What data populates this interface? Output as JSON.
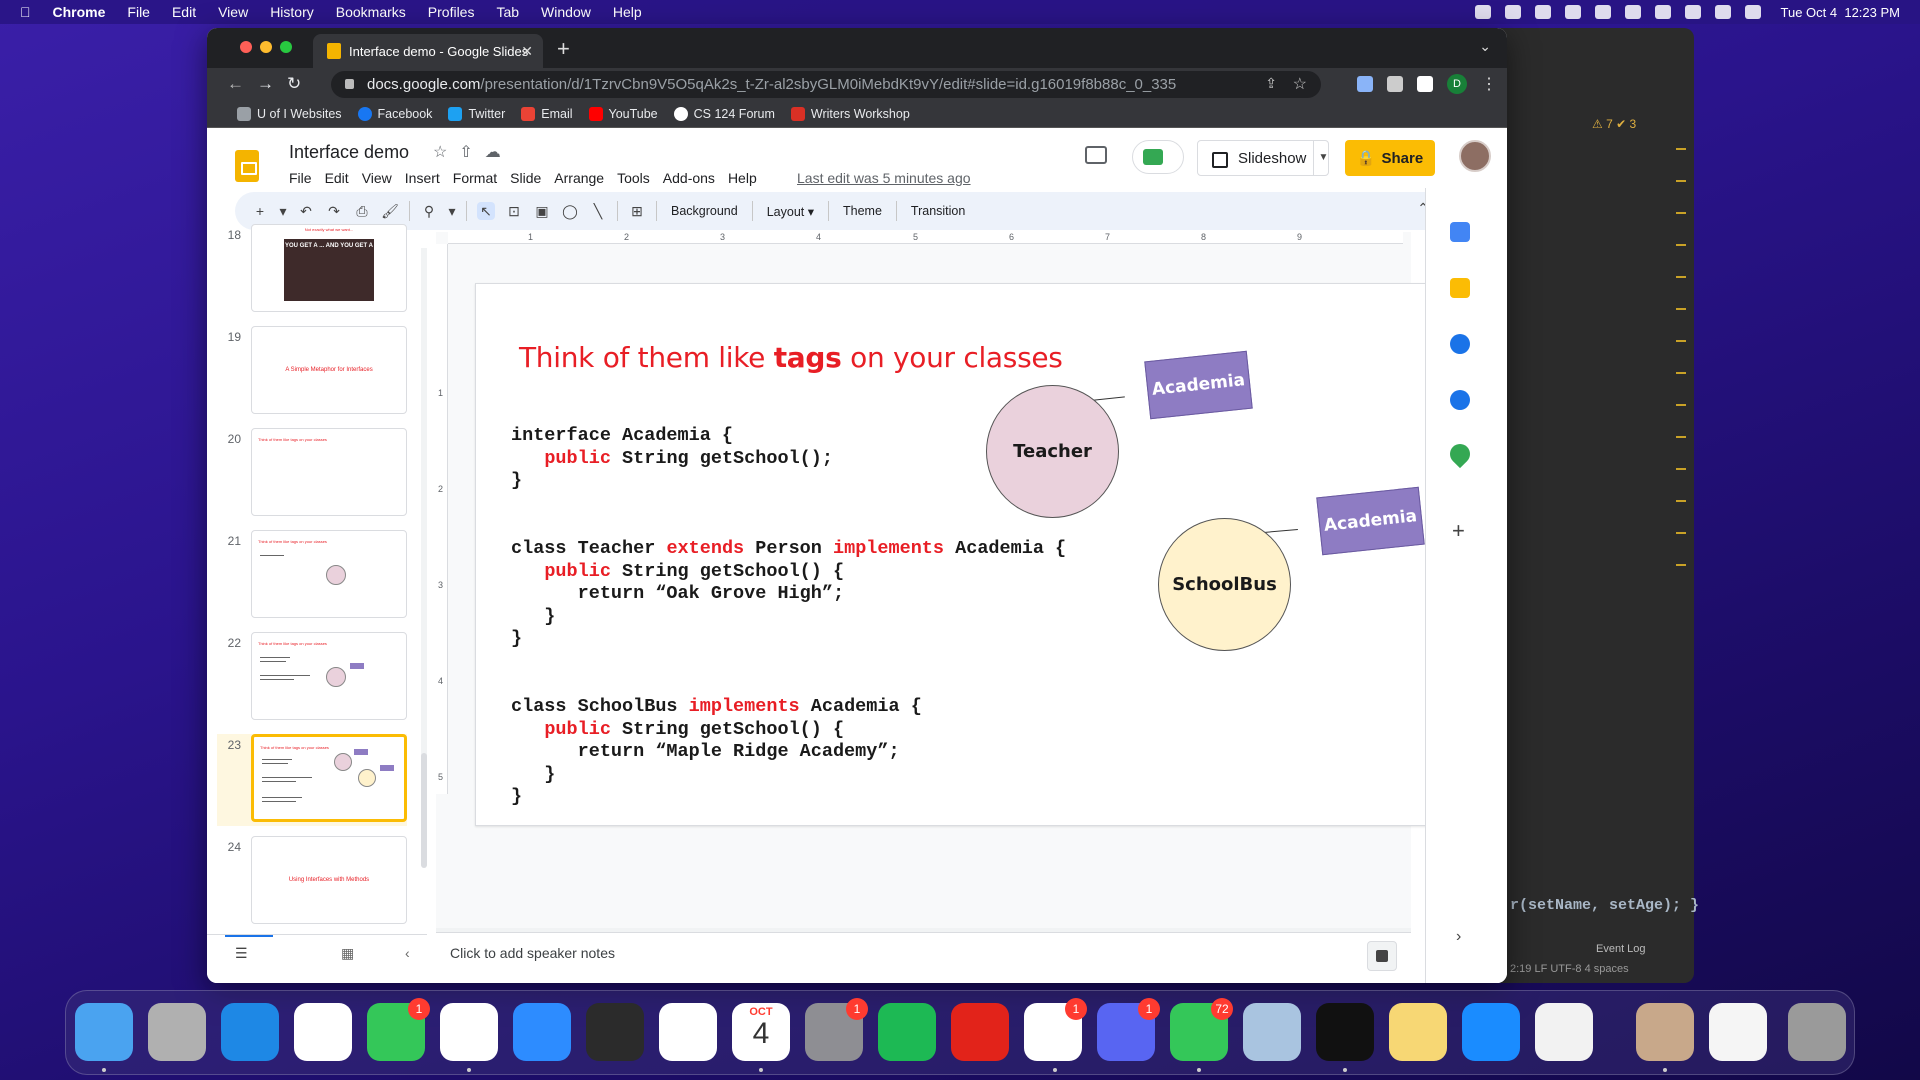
{
  "menubar": {
    "items": [
      "Chrome",
      "File",
      "Edit",
      "View",
      "History",
      "Bookmarks",
      "Profiles",
      "Tab",
      "Window",
      "Help"
    ],
    "clock": "Tue Oct 4  12:23 PM"
  },
  "browser": {
    "tab_title": "Interface demo - Google Slides",
    "url_host": "docs.google.com",
    "url_path": "/presentation/d/1TzrvCbn9V5O5qAk2s_t-Zr-al2sbyGLM0iMebdKt9vY/edit#slide=id.g16019f8b88c_0_335",
    "profile_initial": "D",
    "bookmarks": [
      {
        "label": "U of I Websites",
        "icon": "folder-icon",
        "color": "#9aa0a6"
      },
      {
        "label": "Facebook",
        "icon": "facebook-icon",
        "color": "#1877f2"
      },
      {
        "label": "Twitter",
        "icon": "twitter-icon",
        "color": "#1da1f2"
      },
      {
        "label": "Email",
        "icon": "gmail-icon",
        "color": "#ea4335"
      },
      {
        "label": "YouTube",
        "icon": "youtube-icon",
        "color": "#ff0000"
      },
      {
        "label": "CS 124 Forum",
        "icon": "forum-icon",
        "color": "#ffffff"
      },
      {
        "label": "Writers Workshop",
        "icon": "workshop-icon",
        "color": "#d93025"
      }
    ]
  },
  "slides": {
    "doc_title": "Interface demo",
    "menus": [
      "File",
      "Edit",
      "View",
      "Insert",
      "Format",
      "Slide",
      "Arrange",
      "Tools",
      "Add-ons",
      "Help"
    ],
    "last_edit": "Last edit was 5 minutes ago",
    "slideshow_label": "Slideshow",
    "share_label": "Share",
    "toolbar": {
      "background": "Background",
      "layout": "Layout",
      "theme": "Theme",
      "transition": "Transition"
    },
    "ruler_h": [
      "1",
      "2",
      "3",
      "4",
      "5",
      "6",
      "7",
      "8",
      "9"
    ],
    "ruler_v": [
      "1",
      "2",
      "3",
      "4",
      "5"
    ],
    "thumbnails": [
      {
        "num": "18",
        "top_text": "Not exactly what we want...",
        "img_text": "YOU GET A ... AND YOU GET A"
      },
      {
        "num": "19",
        "center_text": "A Simple Metaphor for Interfaces"
      },
      {
        "num": "20",
        "top_text": "Think of them like tags on your classes"
      },
      {
        "num": "21",
        "top_text": "Think of them like tags on your classes"
      },
      {
        "num": "22",
        "top_text": "Think of them like tags on your classes"
      },
      {
        "num": "23",
        "top_text": "Think of them like tags on your classes"
      },
      {
        "num": "24",
        "center_text": "Using Interfaces with Methods"
      }
    ],
    "speaker_notes_placeholder": "Click to add speaker notes"
  },
  "slide": {
    "title_pre": "Think of them like ",
    "title_bold": "tags",
    "title_post": " on your classes",
    "code1": [
      "interface Academia {",
      "   public String getSchool();",
      "}"
    ],
    "code2": [
      "class Teacher extends Person implements Academia {",
      "   public String getSchool() {",
      "      return “Oak Grove High”;",
      "   }",
      "}"
    ],
    "code3": [
      "class SchoolBus implements Academia {",
      "   public String getSchool() {",
      "      return “Maple Ridge Academy”;",
      "   }",
      "}"
    ],
    "keywords": [
      "public",
      "extends",
      "implements"
    ],
    "circle1": {
      "label": "Teacher",
      "color": "#ead1dc"
    },
    "circle2": {
      "label": "SchoolBus",
      "color": "#fff2cc"
    },
    "tag1": "Academia",
    "tag2": "Academia",
    "tag_color": "#8e7cc3",
    "accent": "#e81e25"
  },
  "ide": {
    "code_line": "r(setName, setAge); }",
    "warnings": "⚠ 7  ✔ 3",
    "event_log": "Event Log",
    "status": "2:19  LF  UTF-8  4 spaces"
  },
  "dock": {
    "apps": [
      "Finder",
      "Launchpad",
      "Xcode",
      "Gmail",
      "FaceTime",
      "Chrome",
      "Zoom",
      "OBS",
      "Calendar",
      "Calendar Date",
      "System Preferences",
      "Spotify",
      "Acrobat",
      "Slack",
      "Discord",
      "Messages",
      "Preview",
      "IntelliJ IDEA",
      "Notes",
      "Safari",
      "TextEdit",
      "Profile",
      "Document",
      "Trash"
    ],
    "calendar_month": "OCT",
    "calendar_day": "4",
    "badges": {
      "facetime": "1",
      "system_prefs": "1",
      "slack": "1",
      "discord": "1",
      "messages": "72"
    }
  }
}
